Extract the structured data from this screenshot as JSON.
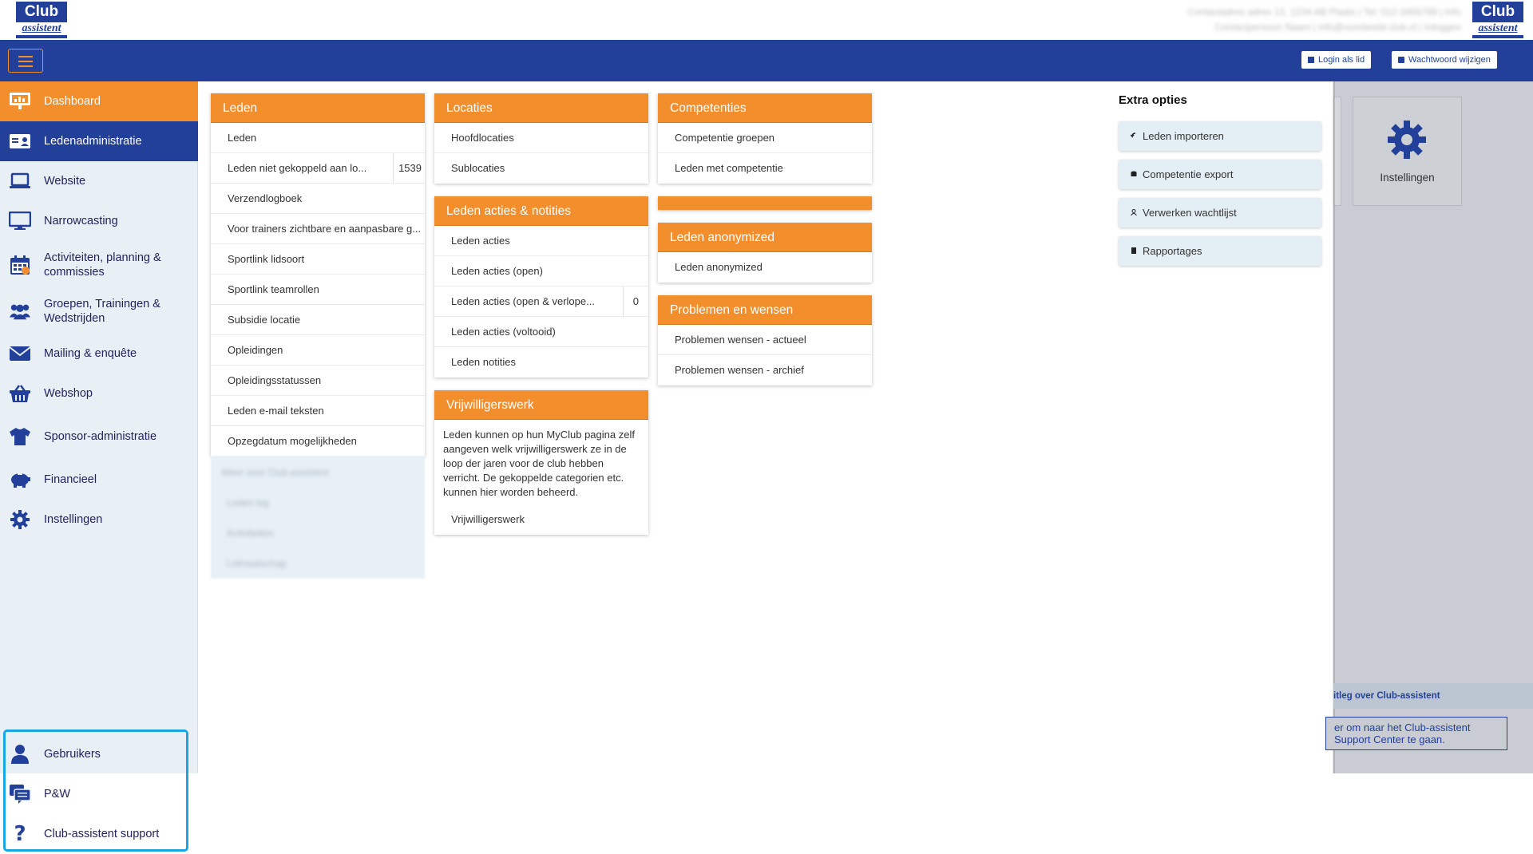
{
  "brand": {
    "logo_line1": "Club",
    "logo_line2": "assistent"
  },
  "header": {
    "info_line1": "Contactadres adres 12, 1234 AB Plaats | Tel: 012-3456789 | Info",
    "info_line2": "Contactpersoon Naam | info@voorbeeld-club.nl | Inloggen"
  },
  "navbar": {
    "login_as_member": "Login als lid",
    "change_password": "Wachtwoord wijzigen"
  },
  "sidebar": {
    "items": [
      {
        "label": "Dashboard"
      },
      {
        "label": "Ledenadministratie"
      },
      {
        "label": "Website"
      },
      {
        "label": "Narrowcasting"
      },
      {
        "label": "Activiteiten, planning & commissies"
      },
      {
        "label": "Groepen, Trainingen & Wedstrijden"
      },
      {
        "label": "Mailing & enquête"
      },
      {
        "label": "Webshop"
      },
      {
        "label": "Sponsor-administratie"
      },
      {
        "label": "Financieel"
      },
      {
        "label": "Instellingen"
      }
    ],
    "bottom_items": [
      {
        "label": "Gebruikers"
      },
      {
        "label": "P&W"
      },
      {
        "label": "Club-assistent support"
      }
    ]
  },
  "cards": {
    "leden": {
      "title": "Leden",
      "rows": [
        {
          "label": "Leden"
        },
        {
          "label": "Leden niet gekoppeld aan lo...",
          "count": "1539"
        },
        {
          "label": "Verzendlogboek"
        },
        {
          "label": "Voor trainers zichtbare en aanpasbare g..."
        },
        {
          "label": "Sportlink lidsoort"
        },
        {
          "label": "Sportlink teamrollen"
        },
        {
          "label": "Subsidie locatie"
        },
        {
          "label": "Opleidingen"
        },
        {
          "label": "Opleidingsstatussen"
        },
        {
          "label": "Leden e-mail teksten"
        },
        {
          "label": "Opzegdatum mogelijkheden"
        }
      ]
    },
    "locaties": {
      "title": "Locaties",
      "rows": [
        {
          "label": "Hoofdlocaties"
        },
        {
          "label": "Sublocaties"
        }
      ]
    },
    "acties": {
      "title": "Leden acties & notities",
      "rows": [
        {
          "label": "Leden acties"
        },
        {
          "label": "Leden acties (open)"
        },
        {
          "label": "Leden acties (open & verlope...",
          "count": "0"
        },
        {
          "label": "Leden acties (voltooid)"
        },
        {
          "label": "Leden notities"
        }
      ]
    },
    "vrijwilligers": {
      "title": "Vrijwilligerswerk",
      "text": "Leden kunnen op hun MyClub pagina zelf aangeven welk vrijwilligerswerk ze in de loop der jaren voor de club hebben verricht. De gekoppelde categorien etc. kunnen hier worden beheerd.",
      "rows": [
        {
          "label": "Vrijwilligerswerk"
        }
      ]
    },
    "competenties": {
      "title": "Competenties",
      "rows": [
        {
          "label": "Competentie groepen"
        },
        {
          "label": "Leden met competentie"
        }
      ]
    },
    "anonymized": {
      "title": "Leden anonymized",
      "rows": [
        {
          "label": "Leden anonymized"
        }
      ]
    },
    "problemen": {
      "title": "Problemen en wensen",
      "rows": [
        {
          "label": "Problemen wensen - actueel"
        },
        {
          "label": "Problemen wensen - archief"
        }
      ]
    }
  },
  "blurred": [
    "Meer over Club-assistent",
    "Leden log",
    "Activiteiten",
    "Lidmaatschap"
  ],
  "extra": {
    "title": "Extra opties",
    "buttons": [
      {
        "label": "Leden importeren"
      },
      {
        "label": "Competentie export"
      },
      {
        "label": "Verwerken wachtlijst"
      },
      {
        "label": "Rapportages"
      }
    ]
  },
  "overlay": {
    "settings_tile": "Instellingen",
    "help_strip": "itleg over Club-assistent",
    "help_btn_line1": "er om naar het Club-assistent",
    "help_btn_line2": "Support Center te gaan."
  },
  "colors": {
    "brand_blue": "#22409a",
    "orange": "#f28e2b",
    "sidebar_bg": "#e8f0f6",
    "highlight": "#1aa6e0"
  }
}
